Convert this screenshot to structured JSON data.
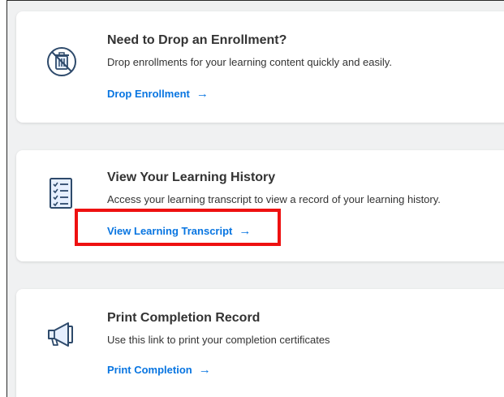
{
  "cards": [
    {
      "icon": "trash-can-no-icon",
      "title": "Need to Drop an Enrollment?",
      "description": "Drop enrollments for your learning content quickly and easily.",
      "link_label": "Drop Enrollment",
      "arrow": "→"
    },
    {
      "icon": "checklist-icon",
      "title": "View Your Learning History",
      "description": "Access your learning transcript to view a record of your learning history.",
      "link_label": "View Learning Transcript",
      "arrow": "→"
    },
    {
      "icon": "megaphone-icon",
      "title": "Print Completion Record",
      "description": "Use this link to print your completion certificates",
      "link_label": "Print Completion",
      "arrow": "→"
    }
  ],
  "colors": {
    "link": "#0875e1",
    "text": "#333333",
    "highlight": "#ee1111",
    "icon_stroke": "#2e4a6b"
  }
}
